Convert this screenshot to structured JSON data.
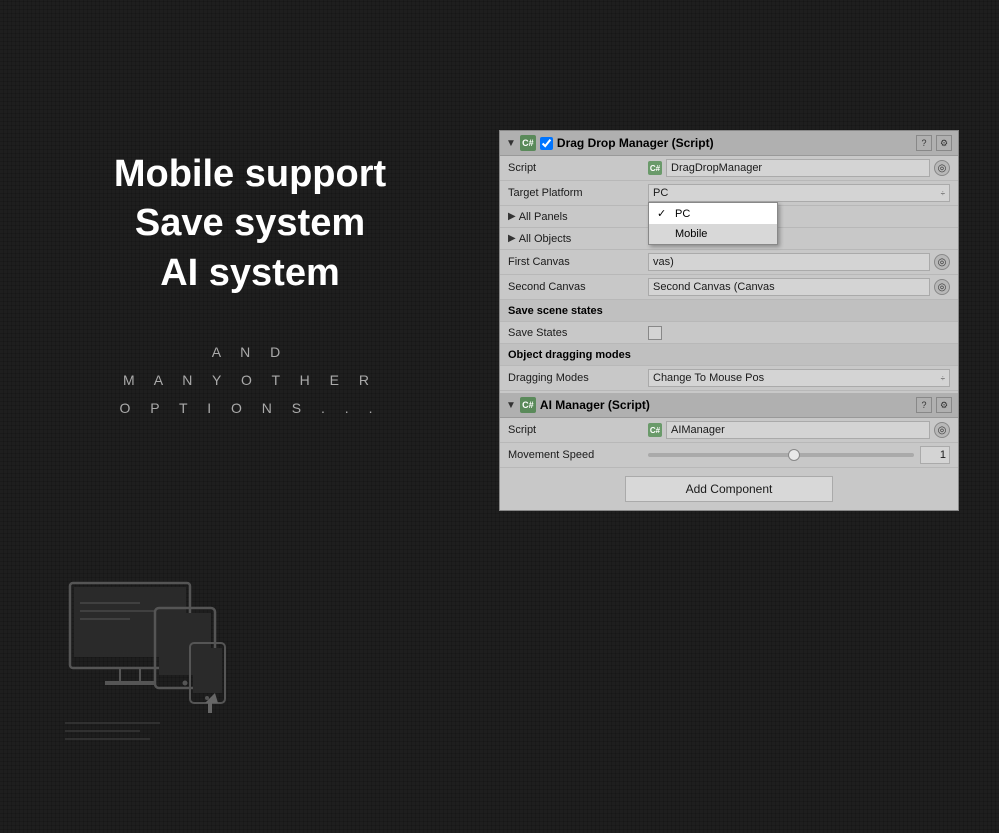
{
  "background": {
    "color": "#1e1e1e"
  },
  "left_panel": {
    "heading_line1": "Mobile support",
    "heading_line2": "Save system",
    "heading_line3": "AI system",
    "subtext_line1": "A N D",
    "subtext_line2": "M A N Y  O T H E R",
    "subtext_line3": "O P T I O N S . . ."
  },
  "unity_inspector": {
    "drag_drop_component": {
      "title": "Drag Drop Manager (Script)",
      "checkbox_checked": true,
      "script_label": "Script",
      "script_value": "DragDropManager",
      "target_platform_label": "Target Platform",
      "target_platform_value": "PC",
      "all_panels_label": "All Panels",
      "all_objects_label": "All Objects",
      "first_canvas_label": "First Canvas",
      "first_canvas_value": "vas)",
      "second_canvas_label": "Second Canvas",
      "second_canvas_value": "Second Canvas (Canvas",
      "save_scene_states_header": "Save scene states",
      "save_states_label": "Save States",
      "object_dragging_header": "Object dragging modes",
      "dragging_modes_label": "Dragging Modes",
      "dragging_modes_value": "Change To Mouse Pos"
    },
    "ai_manager_component": {
      "title": "AI Manager (Script)",
      "script_label": "Script",
      "script_value": "AIManager",
      "movement_speed_label": "Movement Speed",
      "movement_speed_value": "1"
    },
    "add_component_label": "Add Component",
    "dropdown": {
      "options": [
        "PC",
        "Mobile"
      ],
      "selected": "PC",
      "visible": true
    }
  },
  "icons": {
    "component_script": "C#",
    "fold_arrow": "▶",
    "checkmark": "✓",
    "dropdown_arrow": "÷"
  }
}
